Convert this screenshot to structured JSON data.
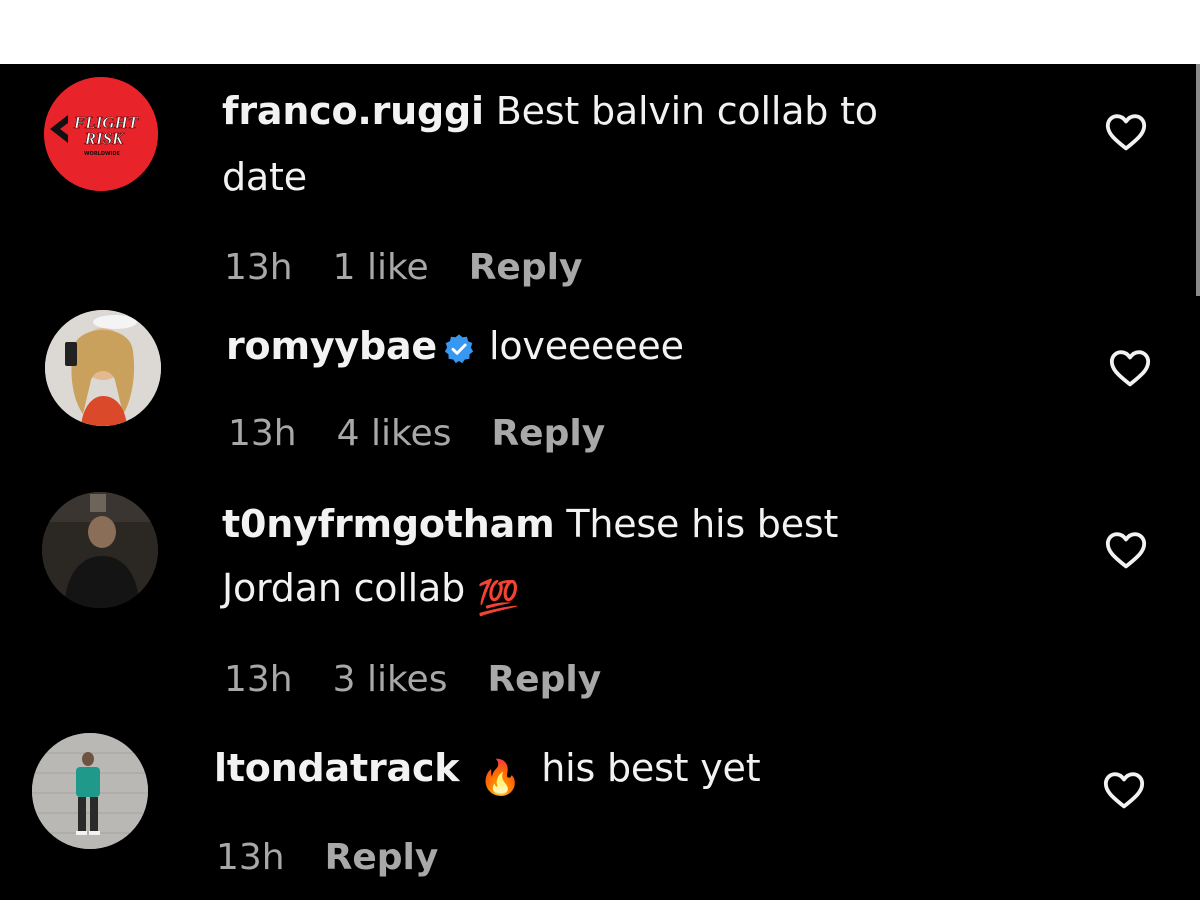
{
  "comments": [
    {
      "username": "franco.ruggi",
      "text_line1": " Best balvin collab to",
      "text_line2": "date",
      "time": "13h",
      "likes": "1 like",
      "reply": "Reply",
      "avatar": {
        "logo_top": "FLIGHT",
        "logo_mid": "RISK",
        "logo_bottom": "WORLDWIDE",
        "color": "#e8242a"
      }
    },
    {
      "username": "romyybae",
      "text_line1": "loveeeeee",
      "time": "13h",
      "likes": "4 likes",
      "reply": "Reply",
      "verified": true
    },
    {
      "username": "t0nyfrmgotham",
      "text_line1": " These his best",
      "text_line2": "Jordan collab ",
      "emoji": "💯",
      "time": "13h",
      "likes": "3 likes",
      "reply": "Reply"
    },
    {
      "username": "ltondatrack",
      "emoji": "🔥",
      "text_line1": "his best yet",
      "time": "13h",
      "reply": "Reply"
    }
  ],
  "icons": {
    "like": "heart-outline-icon",
    "verified": "verified-badge-icon"
  },
  "colors": {
    "background": "#000000",
    "text": "#f2f2f2",
    "meta": "#a8a8a8",
    "verified": "#3897f0",
    "emoji_hundred": "#e0245e"
  }
}
